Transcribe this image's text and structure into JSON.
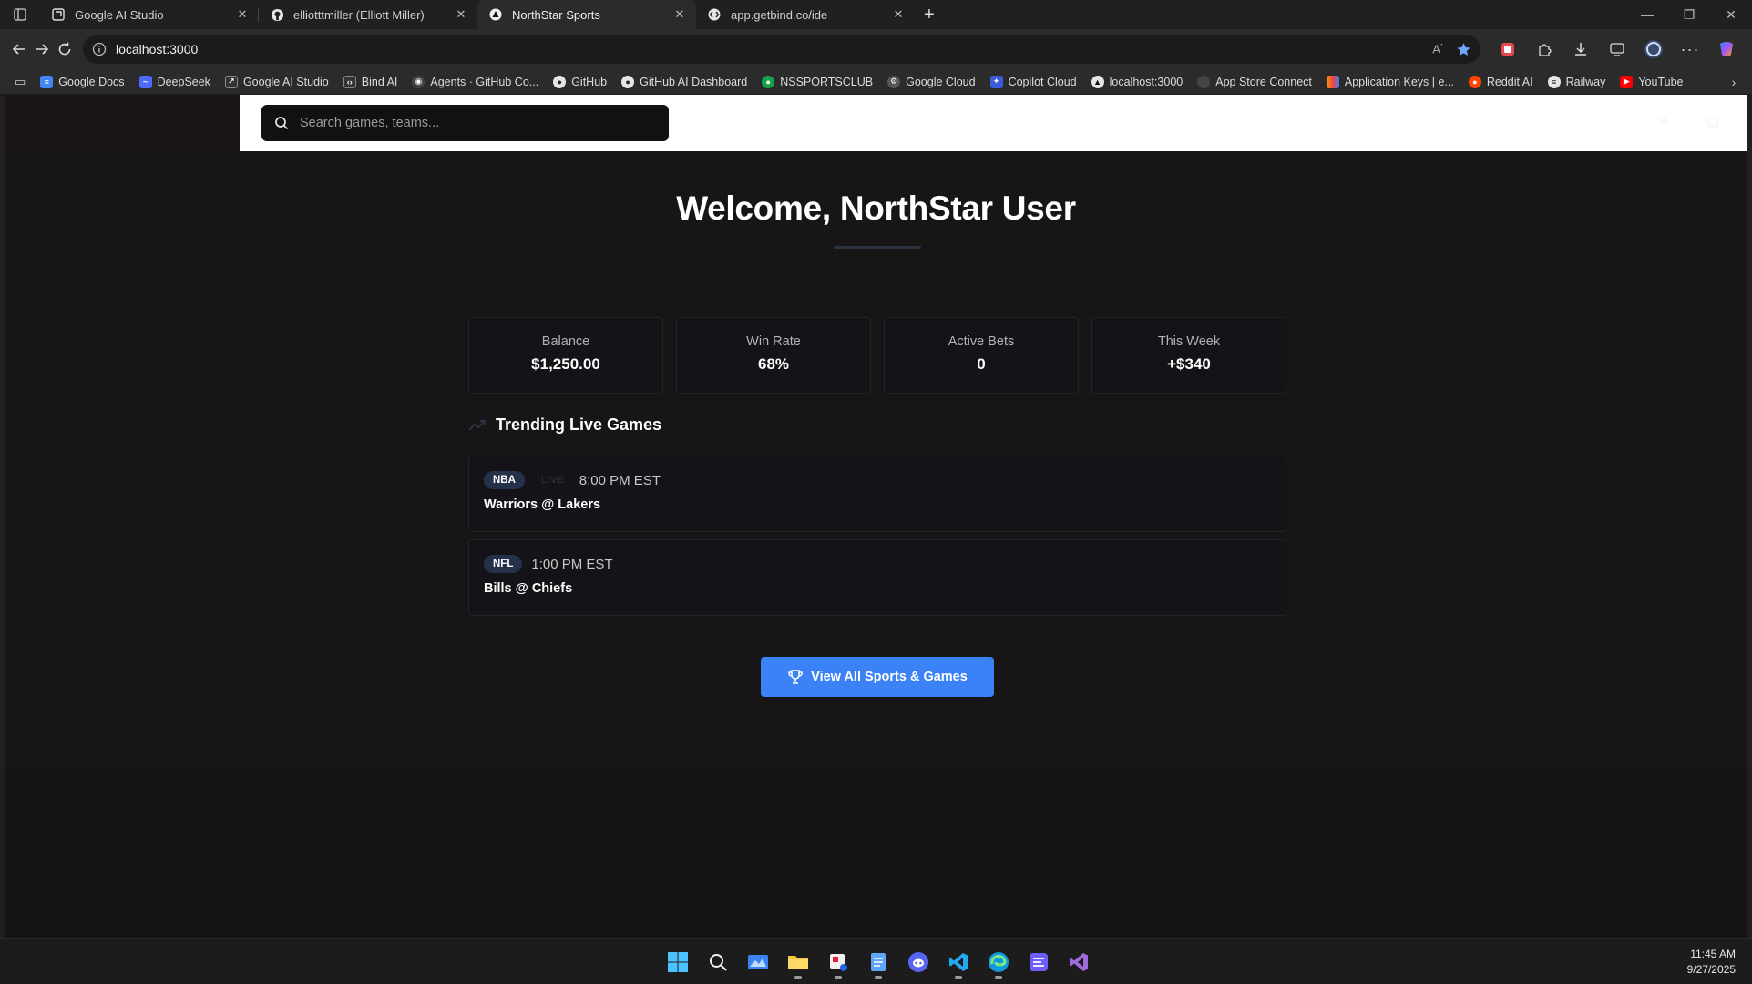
{
  "browser": {
    "tabs": [
      {
        "title": "Google AI Studio",
        "icon": "google-ai-studio-icon",
        "active": false
      },
      {
        "title": "elliotttmiller (Elliott Miller)",
        "icon": "github-icon",
        "active": false
      },
      {
        "title": "NorthStar Sports",
        "icon": "northstar-icon",
        "active": true
      },
      {
        "title": "app.getbind.co/ide",
        "icon": "bind-icon",
        "active": false
      }
    ],
    "url": "localhost:3000",
    "bookmarks": [
      {
        "label": "Google Docs",
        "color": "#4285f4"
      },
      {
        "label": "DeepSeek",
        "color": "#4d6bfe"
      },
      {
        "label": "Google AI Studio",
        "color": "#333333"
      },
      {
        "label": "Bind AI",
        "color": "#333333"
      },
      {
        "label": "Agents · GitHub Co...",
        "color": "#444444"
      },
      {
        "label": "GitHub",
        "color": "#444444"
      },
      {
        "label": "GitHub AI Dashboard",
        "color": "#444444"
      },
      {
        "label": "NSSPORTSCLUB",
        "color": "#16a34a"
      },
      {
        "label": "Google Cloud",
        "color": "#555555"
      },
      {
        "label": "Copilot Cloud",
        "color": "#3b5bdb"
      },
      {
        "label": "localhost:3000",
        "color": "#222222"
      },
      {
        "label": "App Store Connect",
        "color": "#444444"
      },
      {
        "label": "Application Keys | e...",
        "color": "#f59e0b"
      },
      {
        "label": "Reddit AI",
        "color": "#ff4500"
      },
      {
        "label": "Railway",
        "color": "#555555"
      },
      {
        "label": "YouTube",
        "color": "#ff0000"
      }
    ]
  },
  "app": {
    "search_placeholder": "Search games, teams...",
    "welcome": "Welcome, NorthStar User",
    "stats": [
      {
        "label": "Balance",
        "value": "$1,250.00"
      },
      {
        "label": "Win Rate",
        "value": "68%"
      },
      {
        "label": "Active Bets",
        "value": "0"
      },
      {
        "label": "This Week",
        "value": "+$340"
      }
    ],
    "trending_title": "Trending Live Games",
    "games": [
      {
        "league": "NBA",
        "status": "LIVE",
        "time": "8:00 PM EST",
        "matchup": "Warriors @ Lakers"
      },
      {
        "league": "NFL",
        "status": "",
        "time": "1:00 PM EST",
        "matchup": "Bills @ Chiefs"
      }
    ],
    "cta_label": "View All Sports & Games",
    "accent": "#3b82f6"
  },
  "taskbar": {
    "time": "11:45 AM",
    "date": "9/27/2025"
  }
}
